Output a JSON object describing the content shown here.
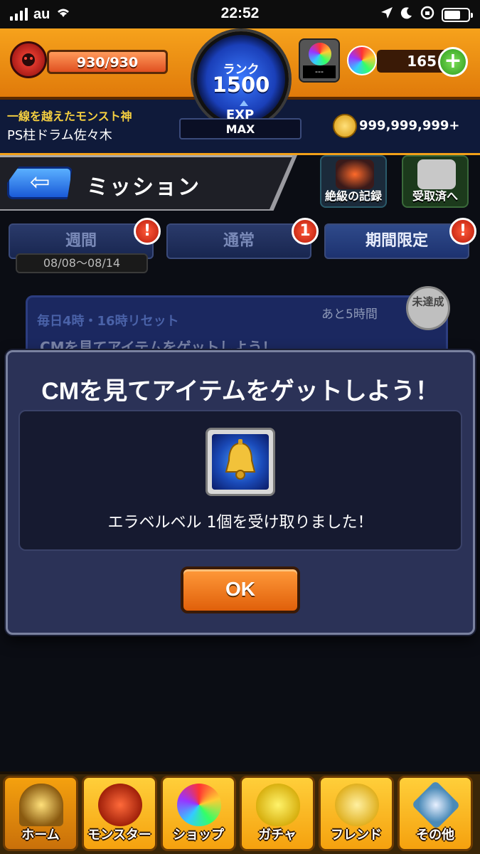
{
  "status_bar": {
    "carrier": "au",
    "time": "22:52"
  },
  "header": {
    "stamina": "930/930",
    "stamina_fraction": 1.0,
    "rank_label": "ランク",
    "rank_value": "1500",
    "exp_label": "EXP",
    "exp_value": "MAX",
    "luck_value": "---",
    "orbs": "165",
    "player_title": "一線を越えたモンスト神",
    "player_name": "PS柱ドラム佐々木",
    "coins": "999,999,999+"
  },
  "title_bar": {
    "title": "ミッション",
    "record_button": "絶級の記録",
    "received_button": "受取済へ"
  },
  "tabs": [
    {
      "label": "週間",
      "badge": "!",
      "active": false
    },
    {
      "label": "通常",
      "badge": "1",
      "active": false
    },
    {
      "label": "期間限定",
      "badge": "!",
      "active": true
    }
  ],
  "date_range": "08/08〜08/14",
  "mission_card": {
    "reset": "毎日4時・16時リセット",
    "remaining": "あと5時間",
    "status": "未達成",
    "text": "CMを見てアイテムをゲットしよう！"
  },
  "dialog": {
    "title": "CMを見てアイテムをゲットしよう！",
    "message": "エラベルベル 1個を受け取りました！",
    "ok_label": "OK"
  },
  "bottom_nav": [
    {
      "label": "ホーム",
      "active": true
    },
    {
      "label": "モンスター",
      "active": false
    },
    {
      "label": "ショップ",
      "active": false
    },
    {
      "label": "ガチャ",
      "active": false
    },
    {
      "label": "フレンド",
      "active": false
    },
    {
      "label": "その他",
      "active": false
    }
  ],
  "colors": {
    "header_orange": "#f6a21c",
    "dialog_bg": "#2b3257",
    "ok_button": "#ff9a3a",
    "nav_gold": "#ffcf3a"
  }
}
